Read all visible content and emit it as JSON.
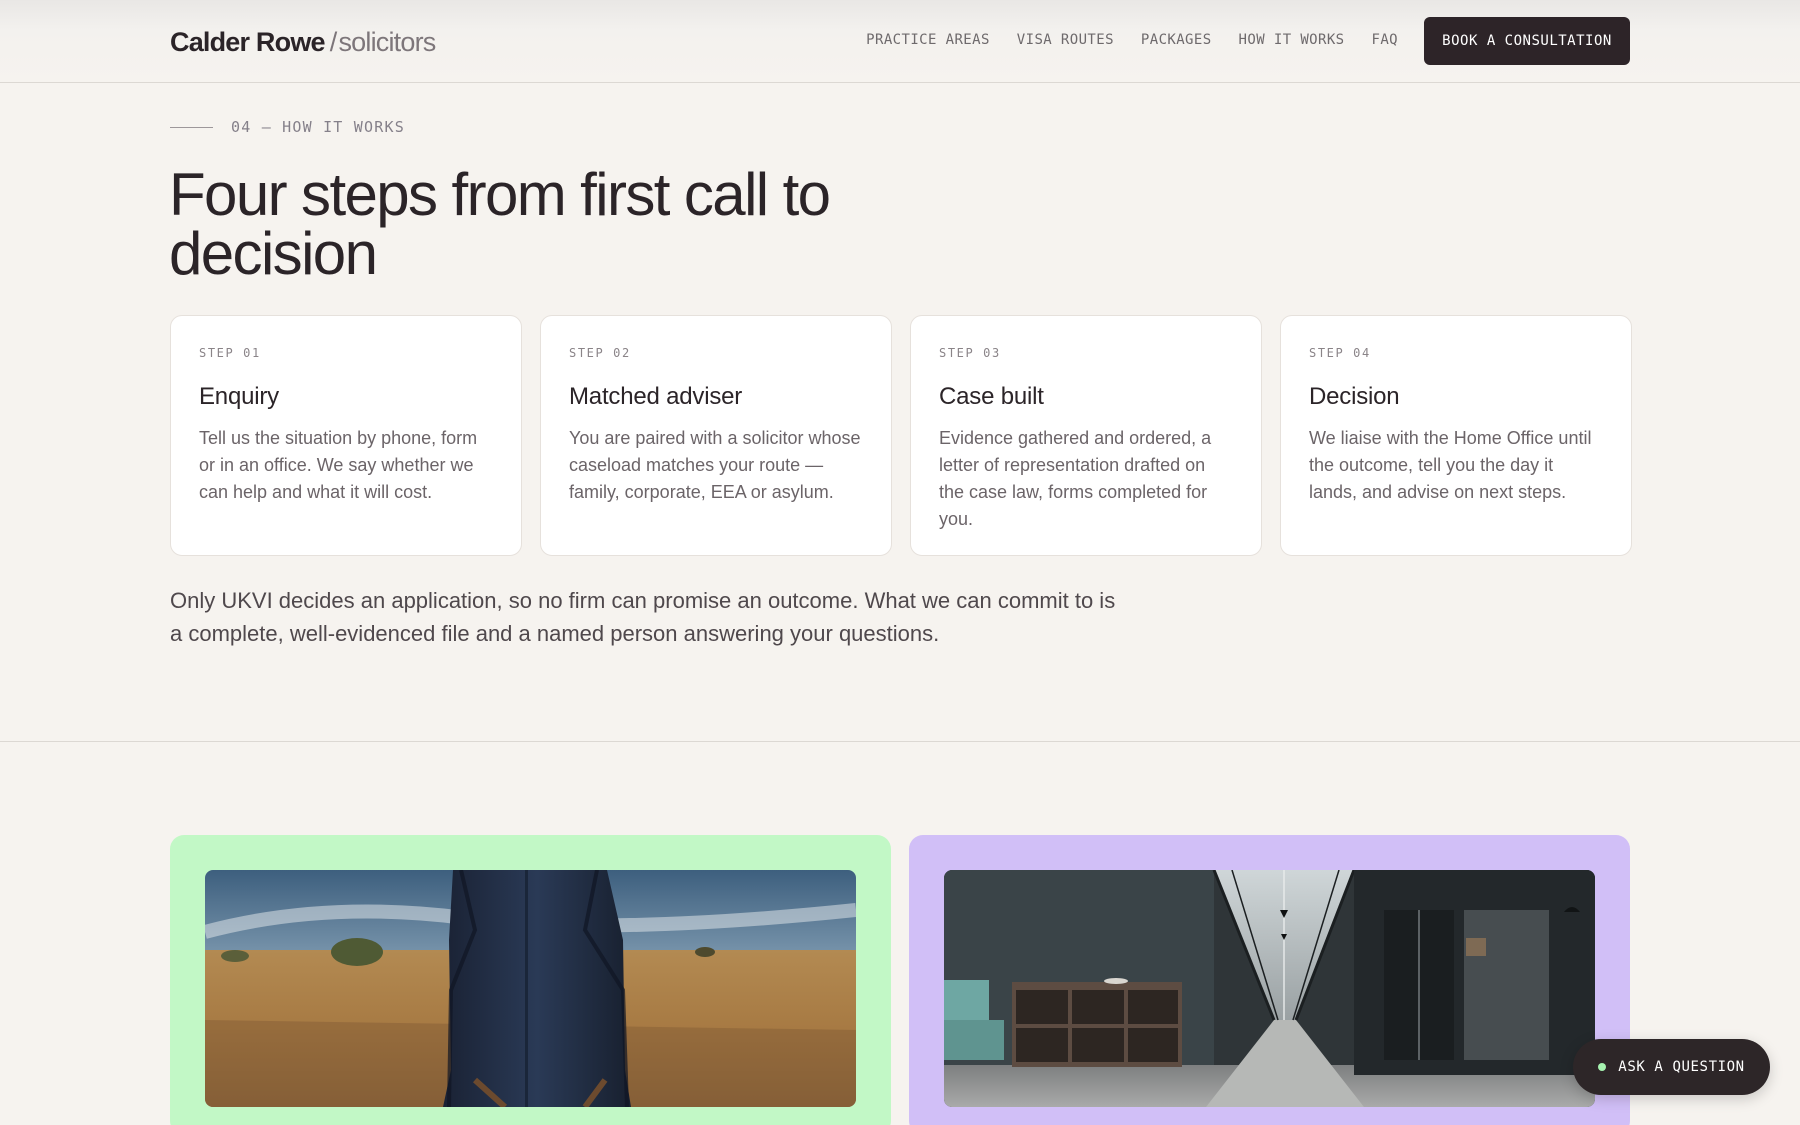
{
  "header": {
    "brand_name": "Calder Rowe",
    "brand_separator": "/",
    "brand_suffix": "solicitors",
    "nav": [
      {
        "label": "PRACTICE AREAS"
      },
      {
        "label": "VISA ROUTES"
      },
      {
        "label": "PACKAGES"
      },
      {
        "label": "HOW IT WORKS"
      },
      {
        "label": "FAQ"
      }
    ],
    "cta_label": "BOOK A CONSULTATION"
  },
  "section": {
    "eyebrow": "04 — HOW IT WORKS",
    "headline": "Four steps from first call to decision",
    "steps": [
      {
        "label": "STEP 01",
        "title": "Enquiry",
        "body": "Tell us the situation by phone, form or in an office. We say whether we can help and what it will cost."
      },
      {
        "label": "STEP 02",
        "title": "Matched adviser",
        "body": "You are paired with a solicitor whose caseload matches your route — family, corporate, EEA or asylum."
      },
      {
        "label": "STEP 03",
        "title": "Case built",
        "body": "Evidence gathered and ordered, a letter of representation drafted on the case law, forms completed for you."
      },
      {
        "label": "STEP 04",
        "title": "Decision",
        "body": "We liaise with the Home Office until the outcome, tell you the day it lands, and advise on next steps."
      }
    ],
    "disclaimer": "Only UKVI decides an application, so no firm can promise an outcome. What we can commit to is a complete, well-evidenced file and a named person answering your questions."
  },
  "media": {
    "left_panel_color": "#c2f8c6",
    "right_panel_color": "#d1bff7"
  },
  "floating": {
    "ask_label": "ASK A QUESTION",
    "indicator_color": "#a6f2b0"
  },
  "colors": {
    "background": "#f6f3ef",
    "ink": "#2b2428",
    "cta": "#2d2428"
  }
}
